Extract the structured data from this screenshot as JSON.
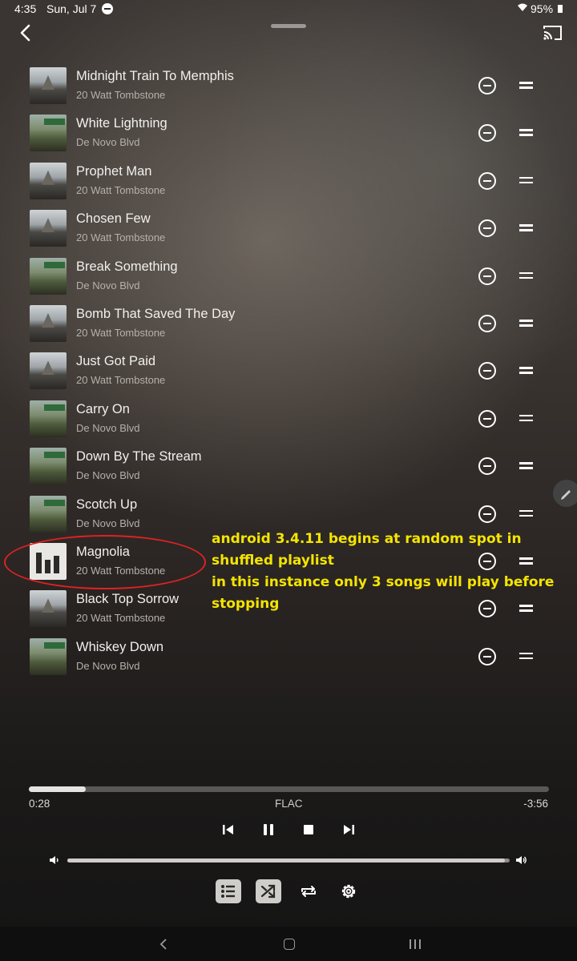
{
  "status": {
    "time": "4:35",
    "date": "Sun, Jul 7",
    "battery": "95%"
  },
  "icons": {
    "back": "back-chevron-icon",
    "cast": "cast-icon",
    "remove": "remove-circle-icon",
    "drag": "drag-handle-icon",
    "edit": "pencil-icon",
    "prev": "skip-previous-icon",
    "pause": "pause-icon",
    "stop": "stop-icon",
    "next": "skip-next-icon",
    "volume_low": "volume-low-icon",
    "volume_high": "volume-high-icon",
    "queue": "queue-list-icon",
    "shuffle": "shuffle-icon",
    "repeat": "repeat-icon",
    "settings": "gear-icon"
  },
  "queue": [
    {
      "title": "Midnight Train To Memphis",
      "artist": "20 Watt Tombstone",
      "art": "tomb"
    },
    {
      "title": "White Lightning",
      "artist": "De Novo Blvd",
      "art": "denovo"
    },
    {
      "title": "Prophet Man",
      "artist": "20 Watt Tombstone",
      "art": "tomb"
    },
    {
      "title": "Chosen Few",
      "artist": "20 Watt Tombstone",
      "art": "tomb"
    },
    {
      "title": "Break Something",
      "artist": "De Novo Blvd",
      "art": "denovo"
    },
    {
      "title": "Bomb That Saved The Day",
      "artist": "20 Watt Tombstone",
      "art": "tomb"
    },
    {
      "title": "Just Got Paid",
      "artist": "20 Watt Tombstone",
      "art": "tomb"
    },
    {
      "title": "Carry On",
      "artist": "De Novo Blvd",
      "art": "denovo"
    },
    {
      "title": "Down By The Stream",
      "artist": "De Novo Blvd",
      "art": "denovo"
    },
    {
      "title": "Scotch Up",
      "artist": "De Novo Blvd",
      "art": "denovo"
    },
    {
      "title": "Magnolia",
      "artist": "20 Watt Tombstone",
      "art": "playing",
      "now_playing": true
    },
    {
      "title": "Black Top Sorrow",
      "artist": "20 Watt Tombstone",
      "art": "tomb"
    },
    {
      "title": "Whiskey Down",
      "artist": "De Novo Blvd",
      "art": "denovo"
    }
  ],
  "annotation": {
    "lines": [
      "android 3.4.11 begins at random spot in",
      "shuffled playlist",
      "in this instance only 3 songs will play before",
      "stopping"
    ],
    "color": "#f4e400",
    "circle_color": "#dd2222"
  },
  "playback": {
    "elapsed": "0:28",
    "format": "FLAC",
    "remaining": "-3:56",
    "progress_fraction": 0.11,
    "volume_fraction": 0.99,
    "shuffle_on": true,
    "queue_view_on": true
  }
}
